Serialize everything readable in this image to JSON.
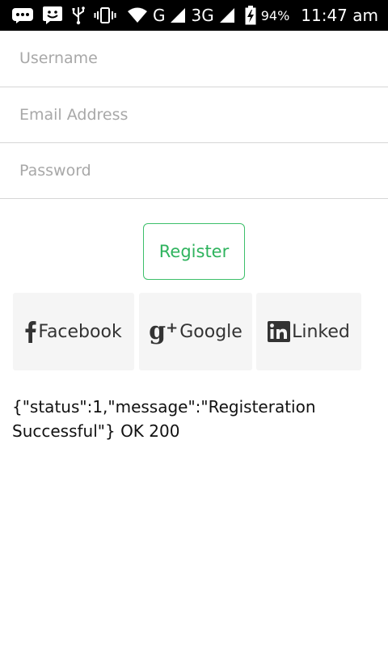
{
  "status_bar": {
    "network_g": "G",
    "network_3g": "3G",
    "battery": "94%",
    "time": "11:47 am",
    "icons": [
      "bbm-icon",
      "chat-icon",
      "usb-icon",
      "vibrate-icon",
      "wifi-icon",
      "signal-icon",
      "battery-icon"
    ]
  },
  "form": {
    "username_placeholder": "Username",
    "email_placeholder": "Email Address",
    "password_placeholder": "Password",
    "register_label": "Register"
  },
  "social": {
    "facebook_label": "Facebook",
    "google_label": "Google",
    "linkedin_label": "Linked"
  },
  "response": {
    "text": "{\"status\":1,\"message\":\"Registeration Successful\"} OK 200"
  },
  "colors": {
    "accent": "#2fb35e",
    "status_bar": "#000000",
    "social_bg": "#f5f5f5"
  }
}
